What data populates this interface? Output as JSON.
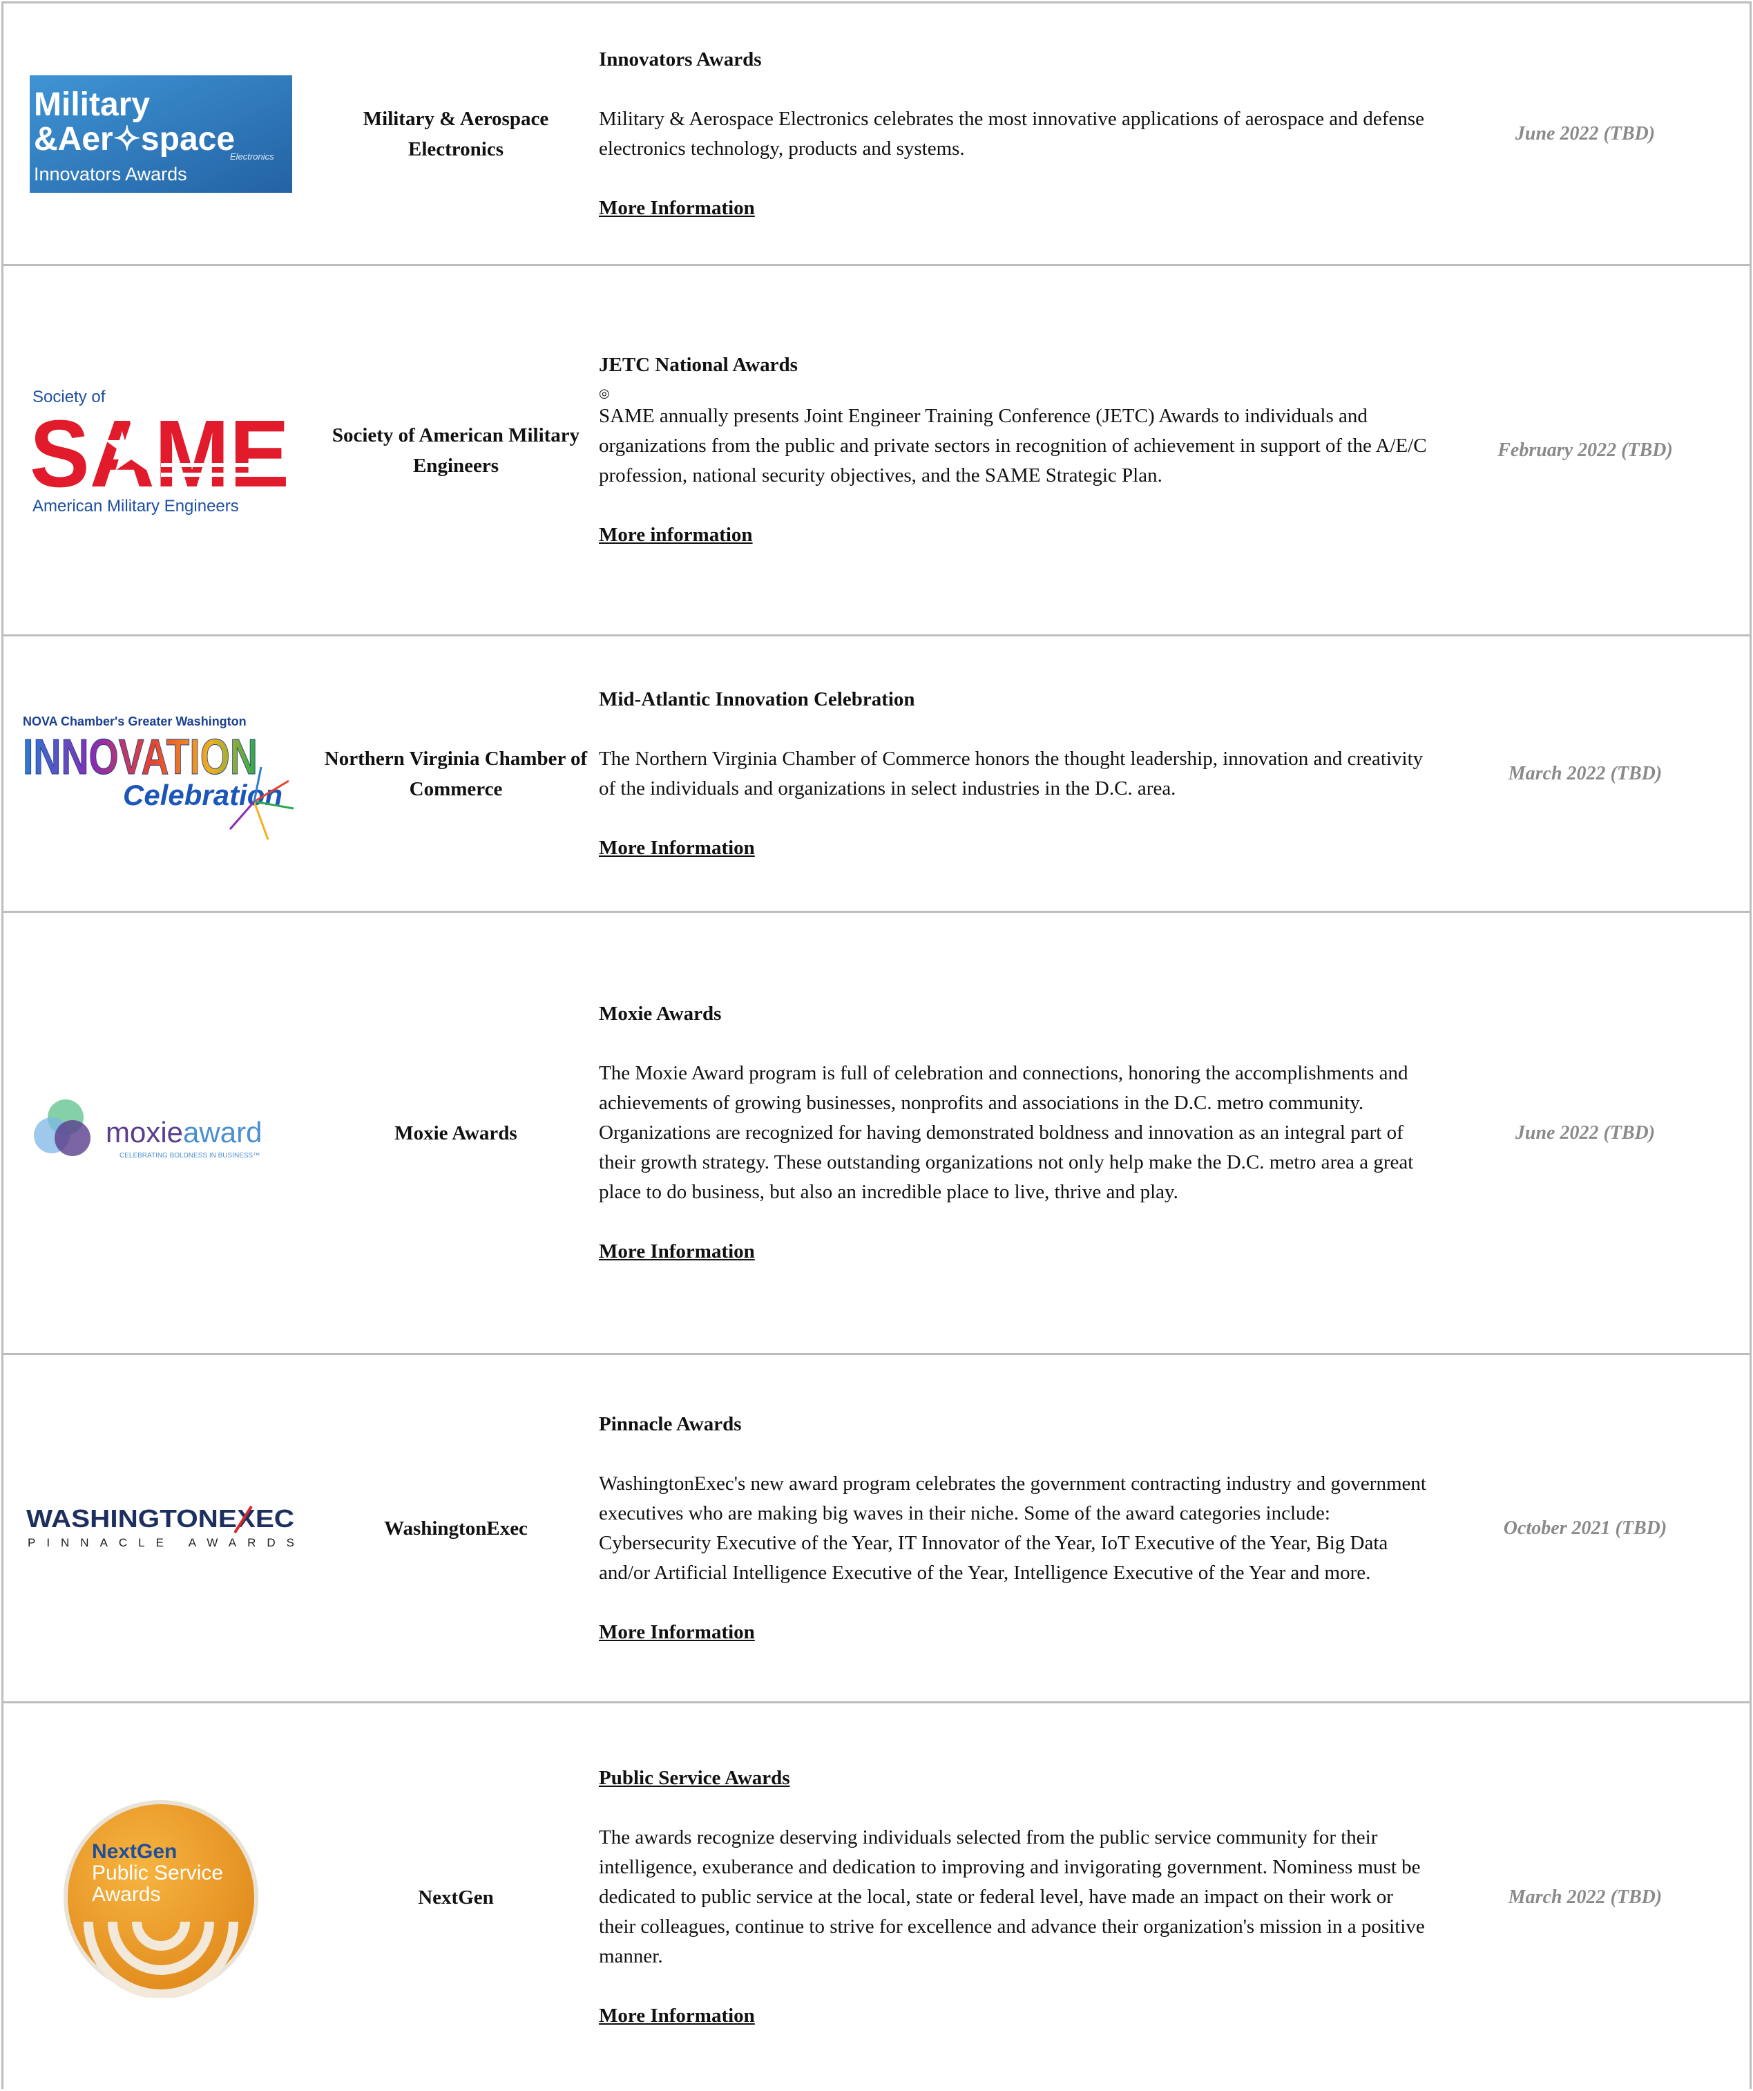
{
  "awards": [
    {
      "org": "Military & Aerospace Electronics",
      "title": "Innovators Awards",
      "description": "Military & Aerospace Electronics celebrates the most innovative applications of aerospace and defense electronics technology, products and systems.",
      "link_text": "More Information",
      "date": "June 2022 (TBD)",
      "logo": {
        "line1": "Military",
        "line2": "&Aer✧space",
        "line3": "Innovators Awards",
        "small": "Electronics",
        "bg": "#2f7fc4"
      }
    },
    {
      "org": "Society of American Military Engineers",
      "title": "JETC National Awards",
      "icon": "small-circle-icon",
      "description": "SAME annually presents Joint Engineer Training Conference (JETC) Awards to individuals and organizations from the public and private sectors in recognition of achievement in support of the A/E/C profession, national security objectives, and the SAME Strategic Plan.",
      "link_text": "More information",
      "date": "February 2022 (TBD)",
      "logo": {
        "top": "Society of",
        "big": "SAME",
        "bottom": "American Military Engineers",
        "red": "#e11b2b",
        "blue": "#1f4fa3"
      }
    },
    {
      "org": "Northern Virginia Chamber of Commerce",
      "title": "Mid-Atlantic Innovation Celebration",
      "description": "The Northern Virginia Chamber of Commerce honors the thought leadership, innovation and creativity of the individuals and organizations in select industries in the D.C. area.",
      "link_text": "More Information",
      "date": "March 2022 (TBD)",
      "logo": {
        "top": "NOVA Chamber's Greater Washington",
        "big": "INNOVATION",
        "bottom": "Celebration"
      }
    },
    {
      "org": "Moxie Awards",
      "title": "Moxie Awards",
      "description": "The Moxie Award program is full of celebration and connections, honoring the accomplishments and achievements of growing businesses, nonprofits and associations in the D.C. metro community. Organizations are recognized for having demonstrated boldness and innovation as an integral part of their growth strategy. These outstanding organizations not only help make the D.C. metro area a great place to do business, but also an incredible place to live, thrive and play.",
      "link_text": "More Information",
      "date": "June 2022 (TBD)",
      "logo": {
        "word1": "moxie",
        "word2": "award",
        "tagline": "CELEBRATING BOLDNESS IN BUSINESS™"
      }
    },
    {
      "org": "WashingtonExec",
      "title": "Pinnacle Awards",
      "description": "WashingtonExec's new award program celebrates the government contracting industry and government executives who are making big waves in their niche. Some of the award categories include: Cybersecurity Executive of the Year, IT Innovator of the Year, IoT Executive of the Year, Big Data and/or Artificial Intelligence Executive of the Year, Intelligence Executive of the Year and more.",
      "link_text": "More Information",
      "date": "October 2021 (TBD)",
      "logo": {
        "word": "WASHINGTONEXEC",
        "sub": "PINNACLE AWARDS"
      }
    },
    {
      "org": "NextGen",
      "title": "Public Service Awards",
      "description": "The awards recognize deserving individuals selected from the public service community for their intelligence, exuberance and dedication to improving and invigorating government. Nominess must be dedicated to public service at the local, state or federal level, have made an impact on their work or their colleagues, continue to strive for excellence and advance their organization's mission in a positive manner.",
      "link_text": "More Information",
      "date": "March 2022 (TBD)",
      "logo": {
        "line1": "NextGen",
        "line2": "Public Service",
        "line3": "Awards",
        "orange": "#f0a02a"
      }
    }
  ]
}
